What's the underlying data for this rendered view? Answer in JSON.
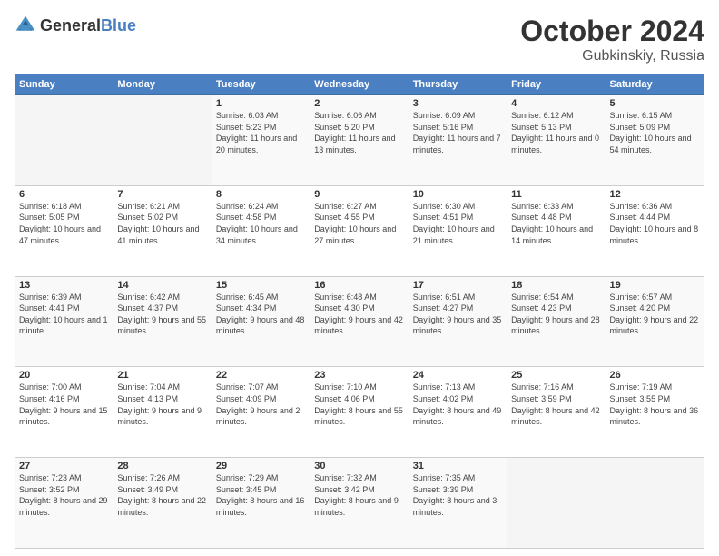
{
  "header": {
    "logo_general": "General",
    "logo_blue": "Blue",
    "month_title": "October 2024",
    "subtitle": "Gubkinskiy, Russia"
  },
  "weekdays": [
    "Sunday",
    "Monday",
    "Tuesday",
    "Wednesday",
    "Thursday",
    "Friday",
    "Saturday"
  ],
  "weeks": [
    [
      {
        "day": "",
        "sunrise": "",
        "sunset": "",
        "daylight": ""
      },
      {
        "day": "",
        "sunrise": "",
        "sunset": "",
        "daylight": ""
      },
      {
        "day": "1",
        "sunrise": "Sunrise: 6:03 AM",
        "sunset": "Sunset: 5:23 PM",
        "daylight": "Daylight: 11 hours and 20 minutes."
      },
      {
        "day": "2",
        "sunrise": "Sunrise: 6:06 AM",
        "sunset": "Sunset: 5:20 PM",
        "daylight": "Daylight: 11 hours and 13 minutes."
      },
      {
        "day": "3",
        "sunrise": "Sunrise: 6:09 AM",
        "sunset": "Sunset: 5:16 PM",
        "daylight": "Daylight: 11 hours and 7 minutes."
      },
      {
        "day": "4",
        "sunrise": "Sunrise: 6:12 AM",
        "sunset": "Sunset: 5:13 PM",
        "daylight": "Daylight: 11 hours and 0 minutes."
      },
      {
        "day": "5",
        "sunrise": "Sunrise: 6:15 AM",
        "sunset": "Sunset: 5:09 PM",
        "daylight": "Daylight: 10 hours and 54 minutes."
      }
    ],
    [
      {
        "day": "6",
        "sunrise": "Sunrise: 6:18 AM",
        "sunset": "Sunset: 5:05 PM",
        "daylight": "Daylight: 10 hours and 47 minutes."
      },
      {
        "day": "7",
        "sunrise": "Sunrise: 6:21 AM",
        "sunset": "Sunset: 5:02 PM",
        "daylight": "Daylight: 10 hours and 41 minutes."
      },
      {
        "day": "8",
        "sunrise": "Sunrise: 6:24 AM",
        "sunset": "Sunset: 4:58 PM",
        "daylight": "Daylight: 10 hours and 34 minutes."
      },
      {
        "day": "9",
        "sunrise": "Sunrise: 6:27 AM",
        "sunset": "Sunset: 4:55 PM",
        "daylight": "Daylight: 10 hours and 27 minutes."
      },
      {
        "day": "10",
        "sunrise": "Sunrise: 6:30 AM",
        "sunset": "Sunset: 4:51 PM",
        "daylight": "Daylight: 10 hours and 21 minutes."
      },
      {
        "day": "11",
        "sunrise": "Sunrise: 6:33 AM",
        "sunset": "Sunset: 4:48 PM",
        "daylight": "Daylight: 10 hours and 14 minutes."
      },
      {
        "day": "12",
        "sunrise": "Sunrise: 6:36 AM",
        "sunset": "Sunset: 4:44 PM",
        "daylight": "Daylight: 10 hours and 8 minutes."
      }
    ],
    [
      {
        "day": "13",
        "sunrise": "Sunrise: 6:39 AM",
        "sunset": "Sunset: 4:41 PM",
        "daylight": "Daylight: 10 hours and 1 minute."
      },
      {
        "day": "14",
        "sunrise": "Sunrise: 6:42 AM",
        "sunset": "Sunset: 4:37 PM",
        "daylight": "Daylight: 9 hours and 55 minutes."
      },
      {
        "day": "15",
        "sunrise": "Sunrise: 6:45 AM",
        "sunset": "Sunset: 4:34 PM",
        "daylight": "Daylight: 9 hours and 48 minutes."
      },
      {
        "day": "16",
        "sunrise": "Sunrise: 6:48 AM",
        "sunset": "Sunset: 4:30 PM",
        "daylight": "Daylight: 9 hours and 42 minutes."
      },
      {
        "day": "17",
        "sunrise": "Sunrise: 6:51 AM",
        "sunset": "Sunset: 4:27 PM",
        "daylight": "Daylight: 9 hours and 35 minutes."
      },
      {
        "day": "18",
        "sunrise": "Sunrise: 6:54 AM",
        "sunset": "Sunset: 4:23 PM",
        "daylight": "Daylight: 9 hours and 28 minutes."
      },
      {
        "day": "19",
        "sunrise": "Sunrise: 6:57 AM",
        "sunset": "Sunset: 4:20 PM",
        "daylight": "Daylight: 9 hours and 22 minutes."
      }
    ],
    [
      {
        "day": "20",
        "sunrise": "Sunrise: 7:00 AM",
        "sunset": "Sunset: 4:16 PM",
        "daylight": "Daylight: 9 hours and 15 minutes."
      },
      {
        "day": "21",
        "sunrise": "Sunrise: 7:04 AM",
        "sunset": "Sunset: 4:13 PM",
        "daylight": "Daylight: 9 hours and 9 minutes."
      },
      {
        "day": "22",
        "sunrise": "Sunrise: 7:07 AM",
        "sunset": "Sunset: 4:09 PM",
        "daylight": "Daylight: 9 hours and 2 minutes."
      },
      {
        "day": "23",
        "sunrise": "Sunrise: 7:10 AM",
        "sunset": "Sunset: 4:06 PM",
        "daylight": "Daylight: 8 hours and 55 minutes."
      },
      {
        "day": "24",
        "sunrise": "Sunrise: 7:13 AM",
        "sunset": "Sunset: 4:02 PM",
        "daylight": "Daylight: 8 hours and 49 minutes."
      },
      {
        "day": "25",
        "sunrise": "Sunrise: 7:16 AM",
        "sunset": "Sunset: 3:59 PM",
        "daylight": "Daylight: 8 hours and 42 minutes."
      },
      {
        "day": "26",
        "sunrise": "Sunrise: 7:19 AM",
        "sunset": "Sunset: 3:55 PM",
        "daylight": "Daylight: 8 hours and 36 minutes."
      }
    ],
    [
      {
        "day": "27",
        "sunrise": "Sunrise: 7:23 AM",
        "sunset": "Sunset: 3:52 PM",
        "daylight": "Daylight: 8 hours and 29 minutes."
      },
      {
        "day": "28",
        "sunrise": "Sunrise: 7:26 AM",
        "sunset": "Sunset: 3:49 PM",
        "daylight": "Daylight: 8 hours and 22 minutes."
      },
      {
        "day": "29",
        "sunrise": "Sunrise: 7:29 AM",
        "sunset": "Sunset: 3:45 PM",
        "daylight": "Daylight: 8 hours and 16 minutes."
      },
      {
        "day": "30",
        "sunrise": "Sunrise: 7:32 AM",
        "sunset": "Sunset: 3:42 PM",
        "daylight": "Daylight: 8 hours and 9 minutes."
      },
      {
        "day": "31",
        "sunrise": "Sunrise: 7:35 AM",
        "sunset": "Sunset: 3:39 PM",
        "daylight": "Daylight: 8 hours and 3 minutes."
      },
      {
        "day": "",
        "sunrise": "",
        "sunset": "",
        "daylight": ""
      },
      {
        "day": "",
        "sunrise": "",
        "sunset": "",
        "daylight": ""
      }
    ]
  ]
}
